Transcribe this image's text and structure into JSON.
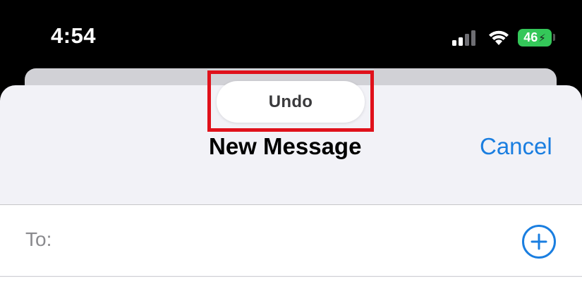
{
  "status_bar": {
    "time": "4:54",
    "battery_level": "46",
    "icons": [
      "cellular-signal-icon",
      "wifi-icon",
      "battery-charging-icon"
    ]
  },
  "undo": {
    "label": "Undo"
  },
  "nav": {
    "title": "New Message",
    "cancel_label": "Cancel"
  },
  "recipient": {
    "label": "To:",
    "value": ""
  },
  "colors": {
    "accent": "#1a7ee0",
    "battery": "#34c759",
    "highlight": "#e0111b",
    "sheet_background": "#f2f2f7"
  }
}
